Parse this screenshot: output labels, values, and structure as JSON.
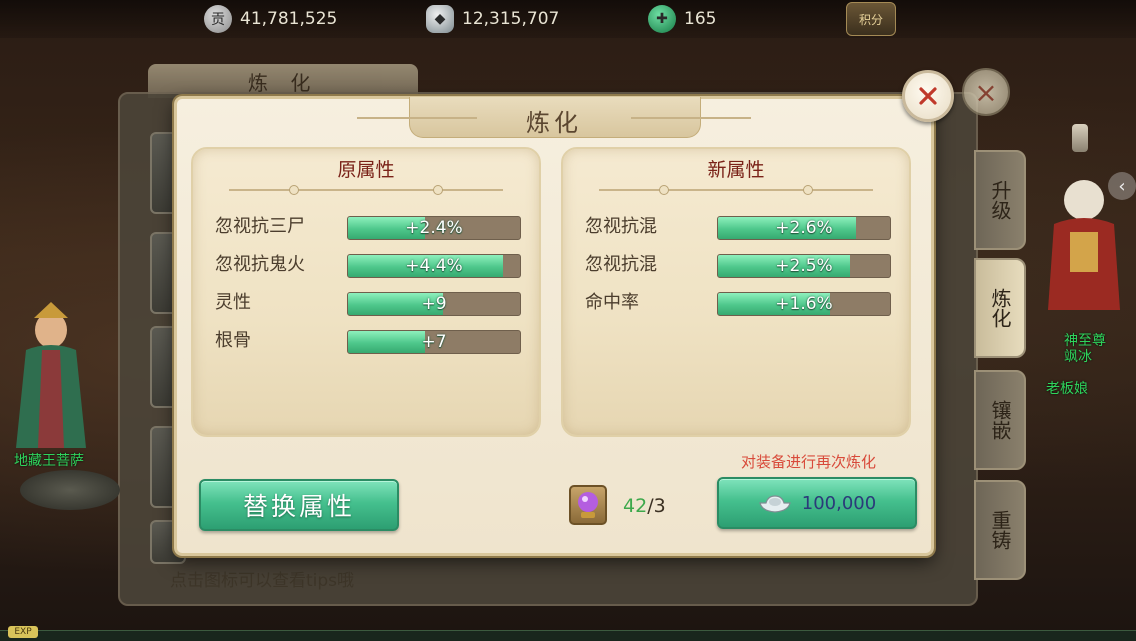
{
  "resources": {
    "coin": "41,781,525",
    "silver": "12,315,707",
    "jade": "165",
    "coin_icon_text": "贡",
    "score_button": "积分"
  },
  "background": {
    "panel_title": "炼 化",
    "hint": "点击图标可以查看tips哦",
    "side_tabs": [
      {
        "label": "升级"
      },
      {
        "label": "炼化"
      },
      {
        "label": "镶嵌"
      },
      {
        "label": "重铸"
      }
    ],
    "npc_left_name": "地藏王菩萨",
    "npc_right_names": [
      "神至尊",
      "飒冰",
      "老板娘"
    ],
    "exp_label": "EXP"
  },
  "dialog": {
    "title": "炼化",
    "original": {
      "heading": "原属性",
      "stats": [
        {
          "name": "忽视抗三尸",
          "value": "+2.4%",
          "fill": 0.45
        },
        {
          "name": "忽视抗鬼火",
          "value": "+4.4%",
          "fill": 0.9
        },
        {
          "name": "灵性",
          "value": "+9",
          "fill": 0.55
        },
        {
          "name": "根骨",
          "value": "+7",
          "fill": 0.45
        }
      ]
    },
    "new": {
      "heading": "新属性",
      "stats": [
        {
          "name": "忽视抗混",
          "value": "+2.6%",
          "fill": 0.8
        },
        {
          "name": "忽视抗混",
          "value": "+2.5%",
          "fill": 0.77
        },
        {
          "name": "命中率",
          "value": "+1.6%",
          "fill": 0.65
        }
      ]
    },
    "refine_hint": "对装备进行再次炼化",
    "replace_button": "替换属性",
    "item": {
      "have": "42",
      "need": "/3"
    },
    "refine_cost": "100,000"
  },
  "colors": {
    "accent_green": "#45c08e",
    "title_red": "#7a2218",
    "hint_red": "#d84a3a"
  }
}
